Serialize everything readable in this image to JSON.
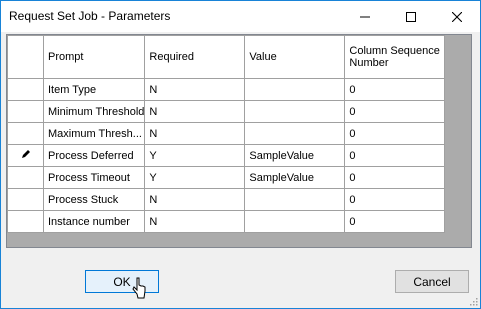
{
  "window": {
    "title": "Request Set Job - Parameters",
    "controls": {
      "minimize": "minimize-icon",
      "maximize": "maximize-icon",
      "close": "close-icon"
    },
    "accent_color": "#1883d7"
  },
  "grid": {
    "columns": [
      "Prompt",
      "Required",
      "Value",
      "Column Sequence Number"
    ],
    "rows": [
      {
        "prompt": "Item Type",
        "required": "N",
        "value": "",
        "seq": "0",
        "editing": false
      },
      {
        "prompt": "Minimum Threshold",
        "required": "N",
        "value": "",
        "seq": "0",
        "editing": false
      },
      {
        "prompt": "Maximum Thresh...",
        "required": "N",
        "value": "",
        "seq": "0",
        "editing": false
      },
      {
        "prompt": "Process Deferred",
        "required": "Y",
        "value": "SampleValue",
        "seq": "0",
        "editing": true
      },
      {
        "prompt": "Process Timeout",
        "required": "Y",
        "value": "SampleValue",
        "seq": "0",
        "editing": false
      },
      {
        "prompt": "Process Stuck",
        "required": "N",
        "value": "",
        "seq": "0",
        "editing": false
      },
      {
        "prompt": "Instance number",
        "required": "N",
        "value": "",
        "seq": "0",
        "editing": false
      }
    ]
  },
  "buttons": {
    "ok_label": "OK",
    "cancel_label": "Cancel"
  }
}
